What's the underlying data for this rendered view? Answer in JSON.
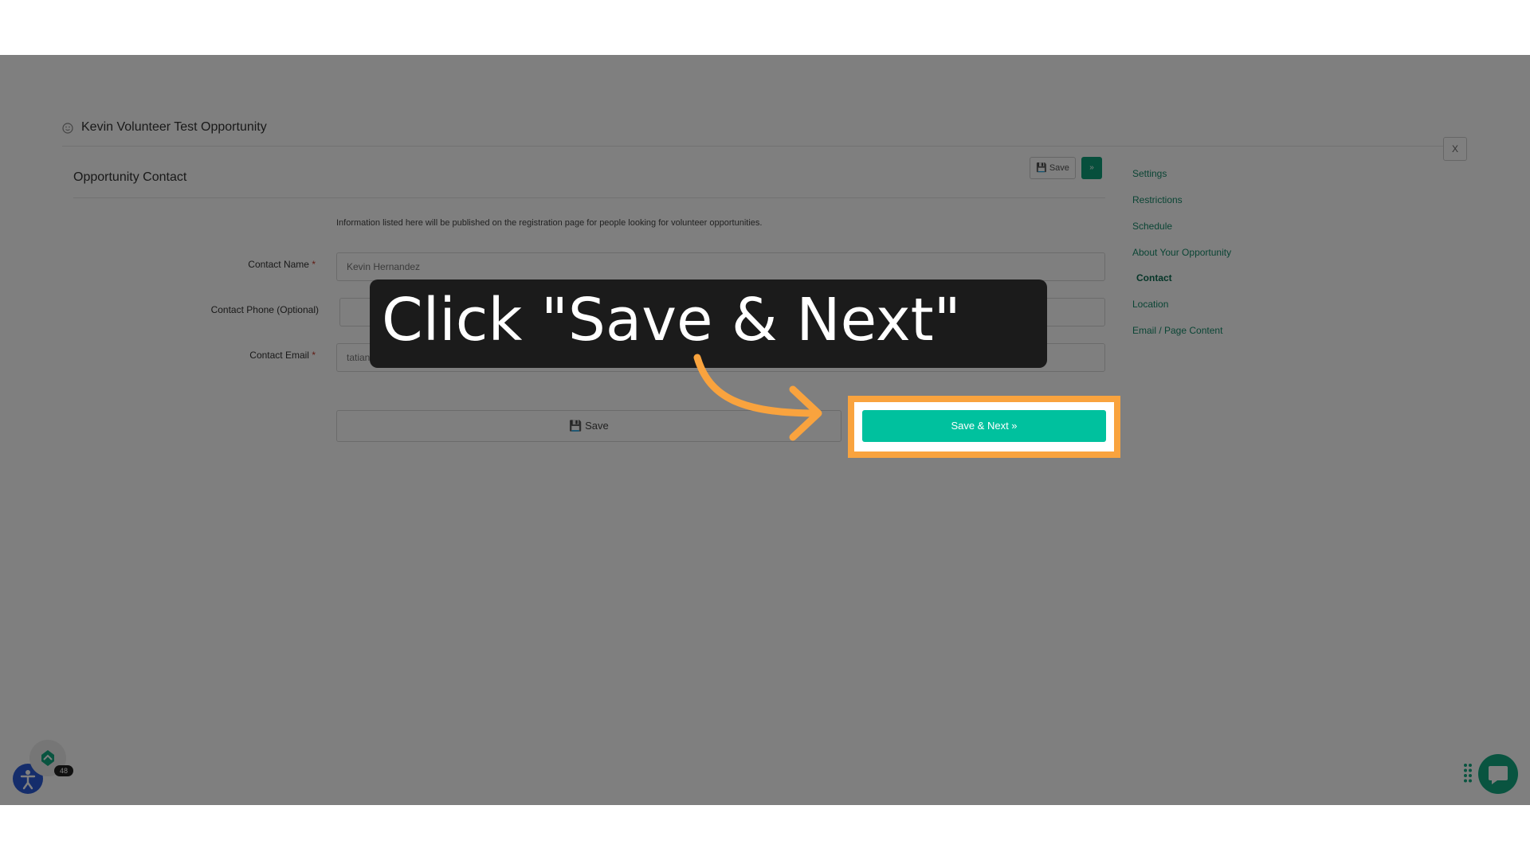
{
  "page": {
    "title": "Kevin Volunteer Test Opportunity",
    "close_label": "X"
  },
  "section": {
    "title": "Opportunity Contact",
    "top_save_label": "Save",
    "top_next_label": "»",
    "info": "Information listed here will be published on the registration page for people looking for volunteer opportunities."
  },
  "fields": [
    {
      "label": "Contact Name",
      "required": "*",
      "value": "Kevin Hernandez",
      "placeholder": ""
    },
    {
      "label": "Contact Phone (Optional)",
      "required": "",
      "value": "",
      "placeholder": ""
    },
    {
      "label": "Contact Email",
      "required": "*",
      "value": "tatiana.yay@gmail.com",
      "placeholder": ""
    }
  ],
  "buttons": {
    "save_label": "Save",
    "save_next_label": "Save & Next »"
  },
  "sidebar": {
    "items": [
      {
        "label": "Settings"
      },
      {
        "label": "Restrictions"
      },
      {
        "label": "Schedule"
      },
      {
        "label": "About Your Opportunity"
      },
      {
        "label": "Contact",
        "active": true
      },
      {
        "label": "Location"
      },
      {
        "label": "Email / Page Content"
      }
    ]
  },
  "callout": {
    "text": "Click \"Save & Next\""
  },
  "widgets": {
    "badge_count": "48"
  },
  "colors": {
    "accent": "#00c19e",
    "highlight": "#f9a33e",
    "nav_link": "#168a6a",
    "a11y_button": "#2a5bd7"
  },
  "icons": [
    "smile-icon",
    "floppy-icon",
    "accessibility-icon",
    "chevron-up-icon",
    "drag-dots-icon",
    "chat-icon"
  ]
}
